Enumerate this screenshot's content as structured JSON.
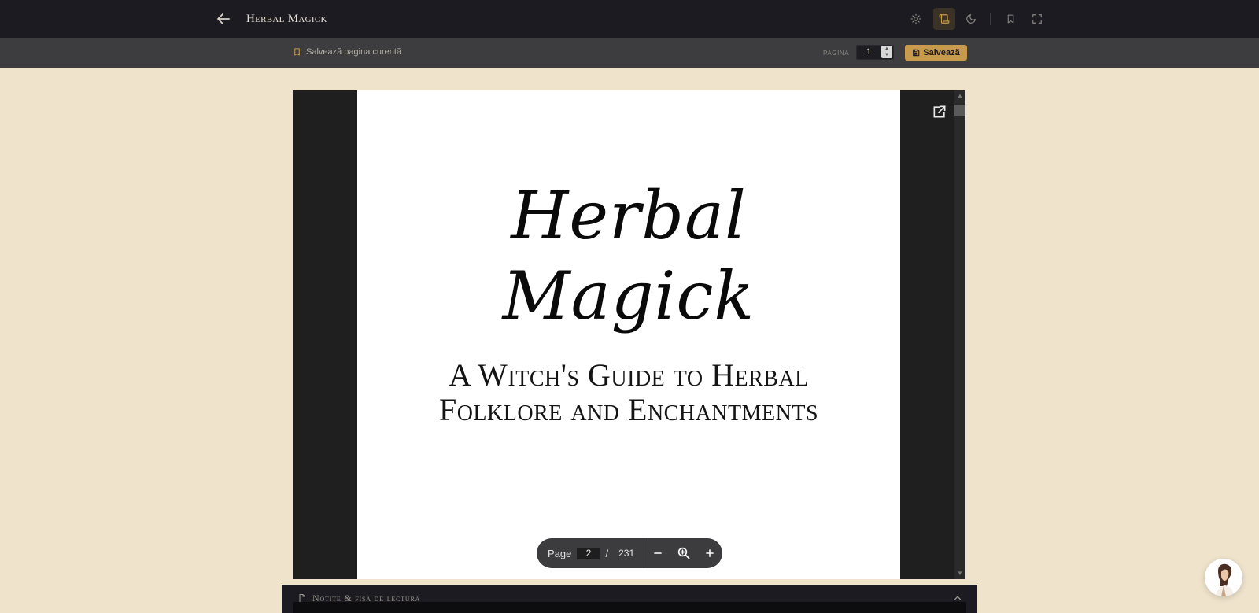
{
  "header": {
    "title": "Herbal Magick",
    "icons": [
      "arrow-left-icon",
      "sun-icon",
      "scroll-icon",
      "moon-icon",
      "bookmark-icon",
      "fullscreen-icon"
    ],
    "accent_color": "#c79a4e"
  },
  "subbar": {
    "save_page_label": "Salvează pagina curentă",
    "page_label": "PAGINA",
    "page_value": "1",
    "save_button_label": "Salvează"
  },
  "pdf": {
    "title_line_1": "Herbal",
    "title_line_2": "Magick",
    "subtitle_line_1": "A Witch's Guide to Herbal",
    "subtitle_line_2": "Folklore and Enchantments",
    "toolbar": {
      "page_label": "Page",
      "current_page": "2",
      "separator": "/",
      "total_pages": "231"
    }
  },
  "notes": {
    "label": "Notițe & fișă de lectură"
  }
}
